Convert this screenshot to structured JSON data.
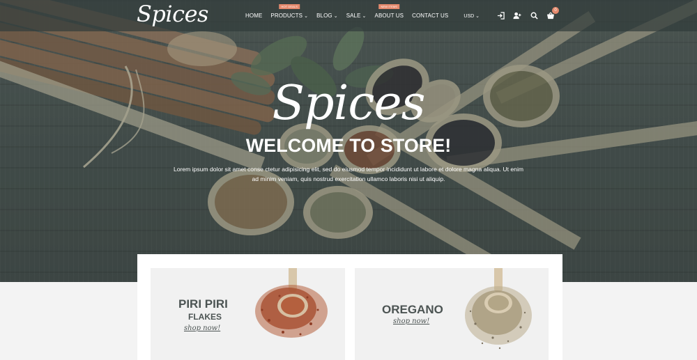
{
  "header": {
    "logo": "Spices",
    "nav": [
      {
        "label": "HOME",
        "chevron": false,
        "badge": ""
      },
      {
        "label": "PRODUCTS",
        "chevron": true,
        "badge": "HOT DEALS"
      },
      {
        "label": "BLOG",
        "chevron": true,
        "badge": ""
      },
      {
        "label": "SALE",
        "chevron": true,
        "badge": ""
      },
      {
        "label": "ABOUT US",
        "chevron": false,
        "badge": "NEW ITEMS"
      },
      {
        "label": "CONTACT US",
        "chevron": false,
        "badge": ""
      }
    ],
    "currency": "USD",
    "icons": [
      "sign-in-icon",
      "add-user-icon",
      "search-icon",
      "cart-icon"
    ],
    "cart_count": "0"
  },
  "hero": {
    "script_title": "Spices",
    "title": "WELCOME TO STORE!",
    "text": "Lorem ipsum dolor sit amet conse ctetur adipisicing elit, sed do eiusmod tempor incididunt ut labore et dolore magna aliqua. Ut enim ad minim veniam, quis nostrud exercitation ullamco laboris nisi ut aliquip."
  },
  "promos": [
    {
      "title": "PIRI PIRI",
      "subtitle": "FLAKES",
      "link": "shop now!",
      "spice_color": "#b4603e"
    },
    {
      "title": "OREGANO",
      "subtitle": "",
      "link": "shop now!",
      "spice_color": "#b9ab8d"
    }
  ],
  "colors": {
    "accent": "#e58a6d",
    "text_dark": "#4c5453",
    "header_bg": "#3a4443"
  }
}
